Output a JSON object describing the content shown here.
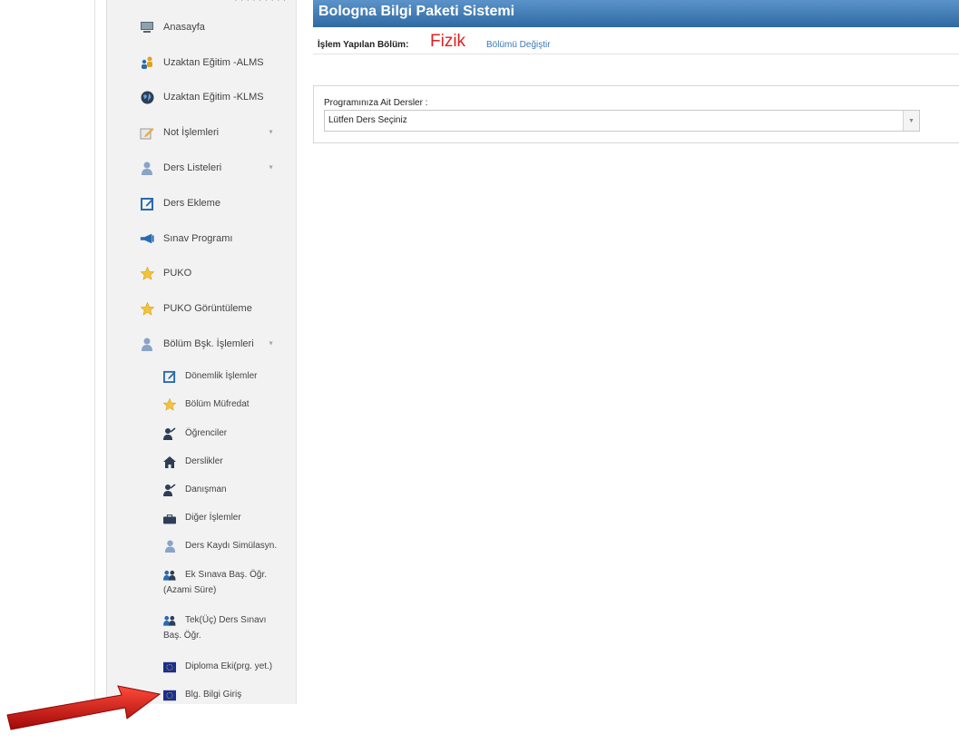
{
  "sidebar": {
    "items": [
      {
        "label": "Anasayfa",
        "icon": "monitor-icon"
      },
      {
        "label": "Uzaktan Eğitim -ALMS",
        "icon": "people-icon"
      },
      {
        "label": "Uzaktan Eğitim -KLMS",
        "icon": "globe-icon"
      },
      {
        "label": "Not İşlemleri",
        "icon": "pencil-icon"
      },
      {
        "label": "Ders Listeleri",
        "icon": "user-icon"
      },
      {
        "label": "Ders Ekleme",
        "icon": "edit-icon"
      },
      {
        "label": "Sınav Programı",
        "icon": "megaphone-icon"
      },
      {
        "label": "PUKO",
        "icon": "star-icon"
      },
      {
        "label": "PUKO Görüntüleme",
        "icon": "star-icon"
      },
      {
        "label": "Bölüm Bşk. İşlemleri",
        "icon": "user-icon"
      }
    ],
    "subitems": [
      {
        "label": "Dönemlik İşlemler",
        "icon": "edit-icon"
      },
      {
        "label": "Bölüm Müfredat",
        "icon": "star-icon"
      },
      {
        "label": "Öğrenciler",
        "icon": "teacher-icon"
      },
      {
        "label": "Derslikler",
        "icon": "home-icon"
      },
      {
        "label": "Danışman",
        "icon": "teacher-icon"
      },
      {
        "label": "Diğer İşlemler",
        "icon": "briefcase-icon"
      },
      {
        "label": "Ders Kaydı Simülasyn.",
        "icon": "user-icon"
      },
      {
        "label": "Ek Sınava Baş. Öğr.",
        "label2": "(Azami Süre)",
        "icon": "group-icon"
      },
      {
        "label": "Tek(Üç) Ders Sınavı",
        "label2": "Baş. Öğr.",
        "icon": "group-icon"
      },
      {
        "label": "Diploma Eki(prg. yet.)",
        "icon": "eu-flag-icon"
      },
      {
        "label": "Blg. Bilgi Giriş",
        "icon": "eu-flag-icon"
      }
    ]
  },
  "header": {
    "title": "Bologna Bilgi Paketi Sistemi",
    "dept_label": "İşlem Yapılan Bölüm:",
    "dept_name": "Fizik",
    "change_link": "Bölümü Değiştir"
  },
  "main": {
    "select_label": "Programınıza Ait Dersler :",
    "select_value": "Lütfen Ders Seçiniz"
  },
  "colors": {
    "header_blue": "#2f6aa3",
    "dept_red": "#e02020",
    "link_blue": "#3b78b8",
    "arrow_red": "#d41414"
  }
}
